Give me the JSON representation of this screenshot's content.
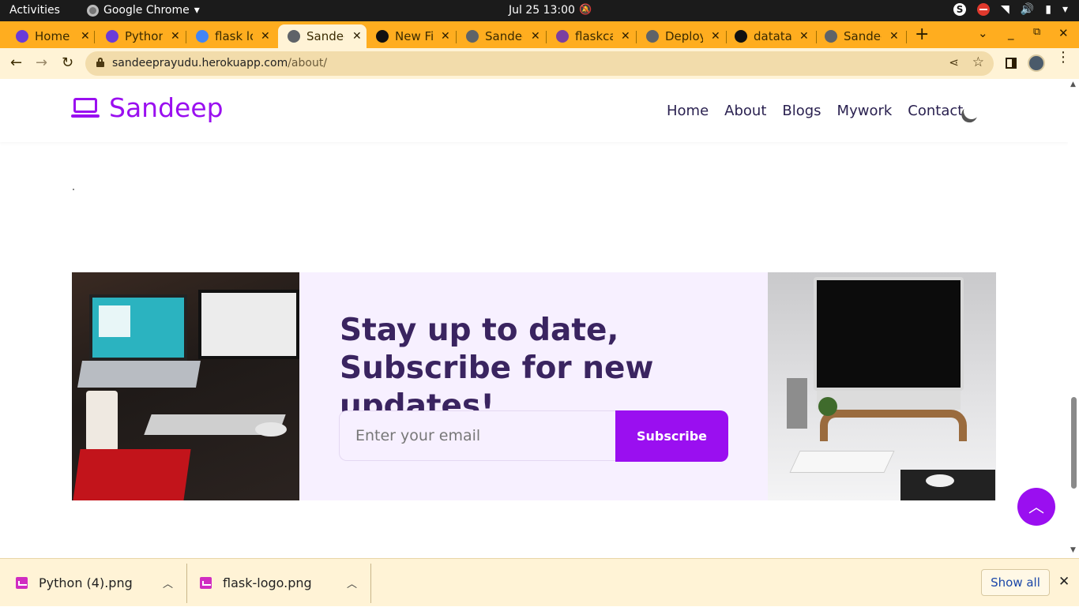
{
  "system": {
    "activities": "Activities",
    "app_name": "Google Chrome",
    "app_menu_arrow": "▾",
    "clock": "Jul 25  13:00",
    "skype_letter": "S"
  },
  "tabs": [
    {
      "label": "Home -",
      "icon_color": "#6a3bd8",
      "active": false
    },
    {
      "label": "Python",
      "icon_color": "#6a3bd8",
      "active": false
    },
    {
      "label": "flask lo",
      "icon_color": "#4285f4",
      "active": false
    },
    {
      "label": "Sandee",
      "icon_color": "#5f6368",
      "active": true
    },
    {
      "label": "New Fil",
      "icon_color": "#111111",
      "active": false
    },
    {
      "label": "Sandee",
      "icon_color": "#5f6368",
      "active": false
    },
    {
      "label": "flaskca",
      "icon_color": "#7b3fa0",
      "active": false
    },
    {
      "label": "Deploy",
      "icon_color": "#5f6368",
      "active": false
    },
    {
      "label": "datatal",
      "icon_color": "#111111",
      "active": false
    },
    {
      "label": "Sandee",
      "icon_color": "#5f6368",
      "active": false
    }
  ],
  "tab_close_glyph": "✕",
  "new_tab_glyph": "+",
  "address": {
    "host": "sandeeprayudu.herokuapp.com",
    "path": "/about/"
  },
  "site": {
    "brand": "Sandeep",
    "nav": [
      "Home",
      "About",
      "Blogs",
      "Mywork",
      "Contact"
    ]
  },
  "subscribe": {
    "title": "Stay up to date, Subscribe for new updates!",
    "email_placeholder": "Enter your email",
    "button_label": "Subscribe"
  },
  "downloads": {
    "items": [
      "Python (4).png",
      "flask-logo.png"
    ],
    "show_all": "Show all"
  },
  "colors": {
    "accent": "#9a0ff0",
    "tabstrip": "#ffad1f",
    "toolbar": "#fff3d6",
    "heading": "#3a2460"
  }
}
